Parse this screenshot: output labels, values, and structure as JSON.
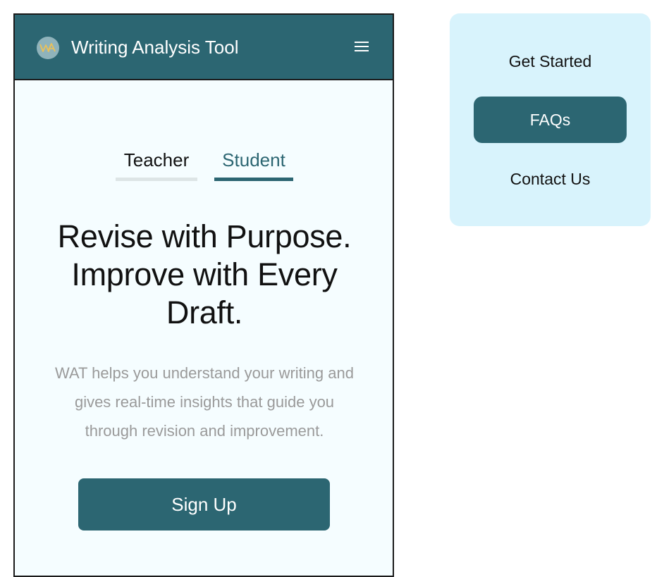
{
  "header": {
    "title": "Writing Analysis Tool",
    "logo_text": "WA",
    "menu_icon": "hamburger-menu-icon"
  },
  "tabs": [
    {
      "label": "Teacher",
      "active": false
    },
    {
      "label": "Student",
      "active": true
    }
  ],
  "hero": {
    "headline": "Revise with Purpose. Improve with Every Draft.",
    "description": "WAT helps you understand your writing and gives real-time insights that guide you through revision and improvement.",
    "cta_label": "Sign Up"
  },
  "menu": {
    "items": [
      {
        "label": "Get Started",
        "active": false
      },
      {
        "label": "FAQs",
        "active": true
      },
      {
        "label": "Contact Us",
        "active": false
      }
    ]
  },
  "colors": {
    "primary": "#2c6672",
    "background": "#f5fdff",
    "menu_background": "#d8f3fc",
    "muted_text": "#9a9a9a",
    "inactive_tab_underline": "#dde5e6"
  }
}
